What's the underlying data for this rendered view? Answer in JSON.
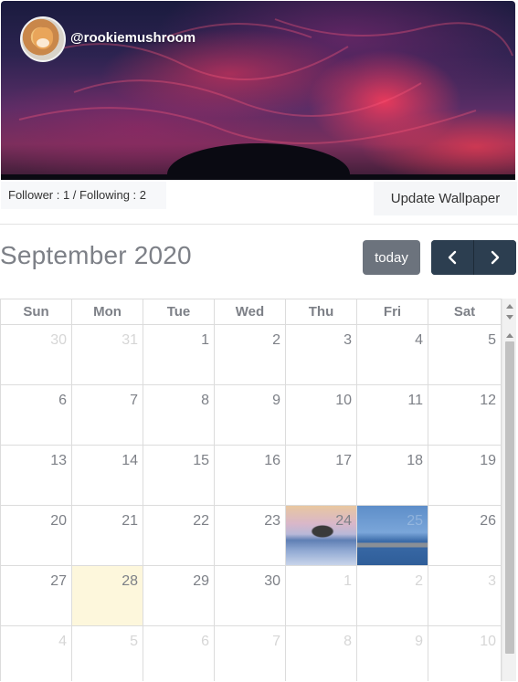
{
  "profile": {
    "username": "@rookiemushroom",
    "follow_text": "Follower : 1 / Following : 2",
    "update_wallpaper_label": "Update Wallpaper"
  },
  "calendar": {
    "title": "September 2020",
    "today_label": "today",
    "prev_icon": "chevron-left-icon",
    "next_icon": "chevron-right-icon",
    "weekdays": [
      "Sun",
      "Mon",
      "Tue",
      "Wed",
      "Thu",
      "Fri",
      "Sat"
    ],
    "weeks": [
      [
        "30",
        "31",
        "1",
        "2",
        "3",
        "4",
        "5"
      ],
      [
        "6",
        "7",
        "8",
        "9",
        "10",
        "11",
        "12"
      ],
      [
        "13",
        "14",
        "15",
        "16",
        "17",
        "18",
        "19"
      ],
      [
        "20",
        "21",
        "22",
        "23",
        "24",
        "25",
        "26"
      ],
      [
        "27",
        "28",
        "29",
        "30",
        "1",
        "2",
        "3"
      ],
      [
        "4",
        "5",
        "6",
        "7",
        "8",
        "9",
        "10"
      ]
    ],
    "today_date": "28"
  },
  "colors": {
    "nav_button": "#2c3e50",
    "today_button": "#6c737d",
    "today_highlight": "#fdf7dc",
    "muted_text": "#7d8087"
  }
}
